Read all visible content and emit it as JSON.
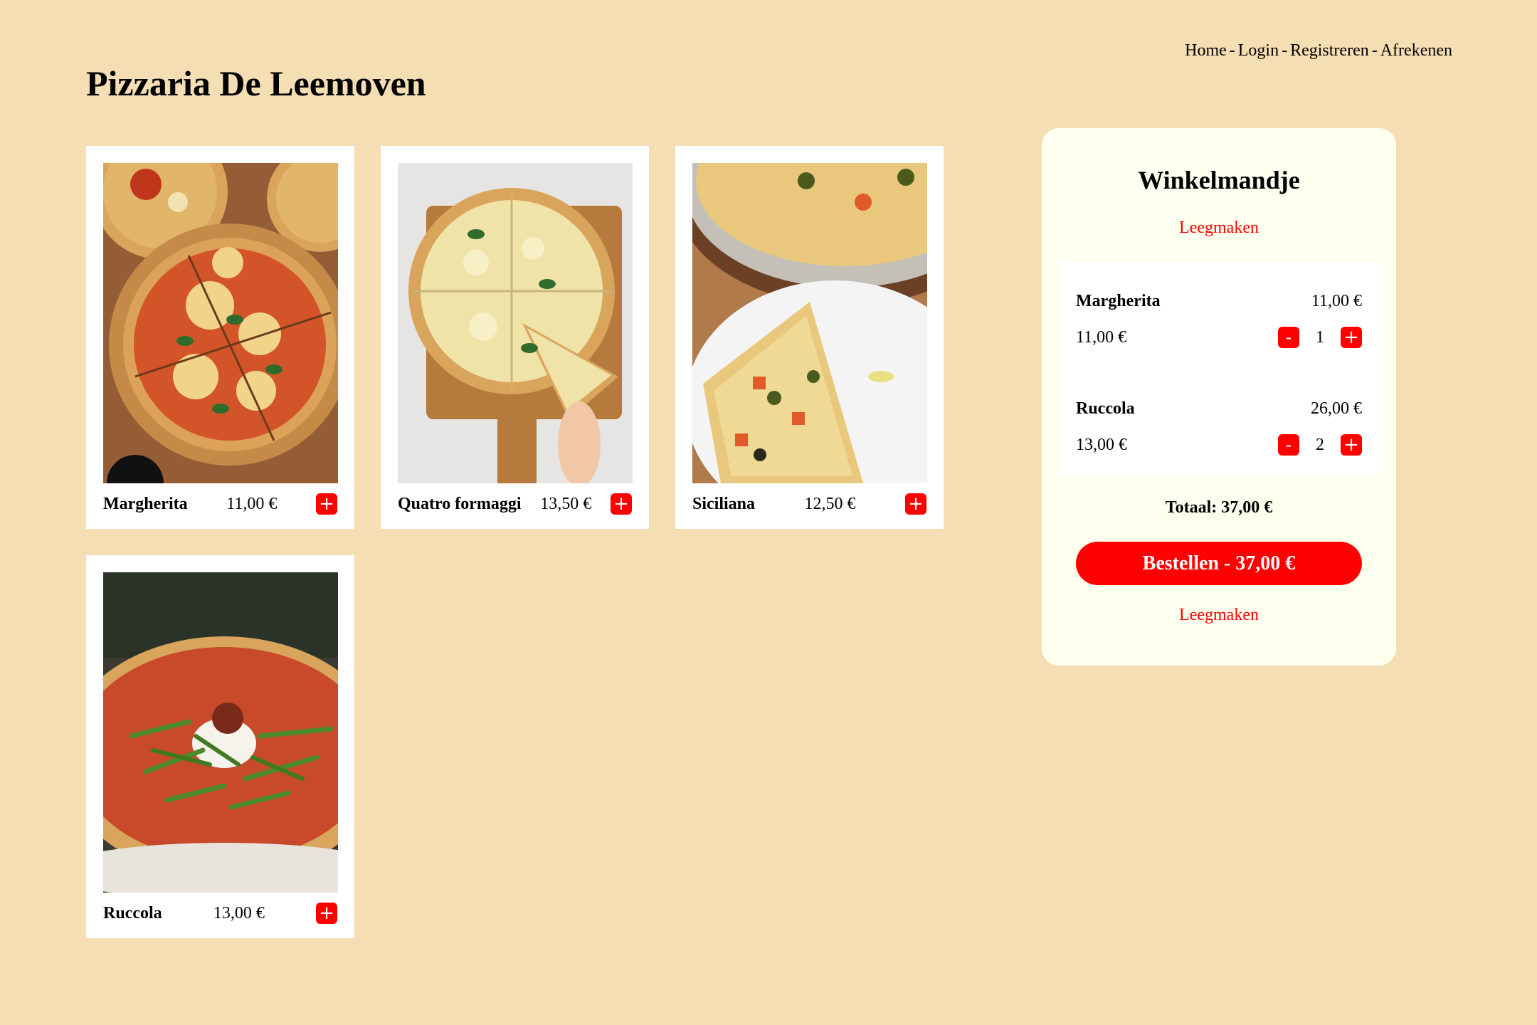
{
  "header": {
    "title": "Pizzaria De Leemoven",
    "nav": [
      "Home",
      "Login",
      "Registreren",
      "Afrekenen"
    ],
    "nav_separator": "-"
  },
  "products": [
    {
      "name": "Margherita",
      "price": "11,00 €",
      "add_label": "+"
    },
    {
      "name": "Quatro formaggi",
      "price": "13,50 €",
      "add_label": "+"
    },
    {
      "name": "Siciliana",
      "price": "12,50 €",
      "add_label": "+"
    },
    {
      "name": "Ruccola",
      "price": "13,00 €",
      "add_label": "+"
    }
  ],
  "cart": {
    "title": "Winkelmandje",
    "clear_label": "Leegmaken",
    "items": [
      {
        "name": "Margherita",
        "line_total": "11,00 €",
        "unit_price": "11,00 €",
        "quantity": "1",
        "minus_label": "-",
        "plus_label": "+"
      },
      {
        "name": "Ruccola",
        "line_total": "26,00 €",
        "unit_price": "13,00 €",
        "quantity": "2",
        "minus_label": "-",
        "plus_label": "+"
      }
    ],
    "total_label": "Totaal: 37,00 €",
    "order_label": "Bestellen - 37,00 €"
  },
  "colors": {
    "background": "#f5deb3",
    "accent": "#ff0000",
    "cart_background": "#fffff0"
  }
}
